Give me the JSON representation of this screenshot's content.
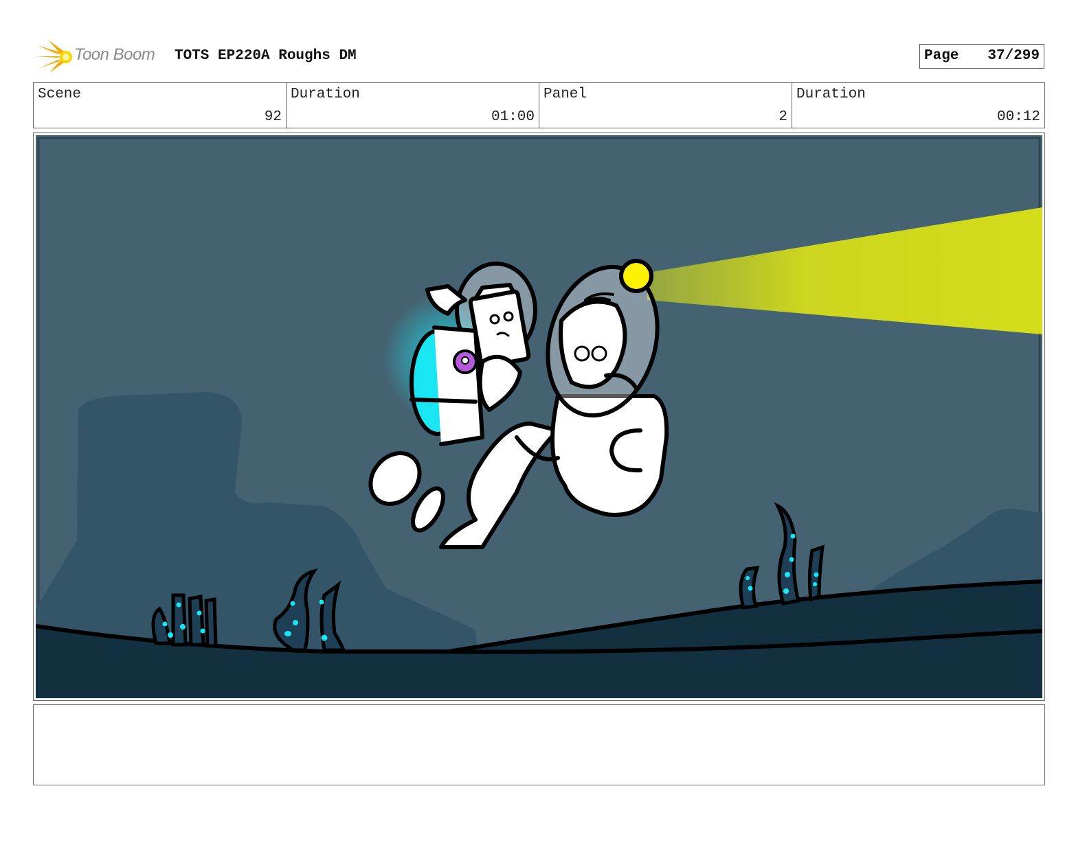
{
  "header": {
    "logo_text": "Toon Boom",
    "title": "TOTS EP220A Roughs DM",
    "page_label": "Page",
    "page_value": "37/299"
  },
  "info": {
    "scene_label": "Scene",
    "scene_value": "92",
    "scene_duration_label": "Duration",
    "scene_duration_value": "01:00",
    "panel_label": "Panel",
    "panel_value": "2",
    "panel_duration_label": "Duration",
    "panel_duration_value": "00:12"
  },
  "notes": {
    "text": ""
  },
  "colors": {
    "water": "#456272",
    "rocks": "#335567",
    "seabed": "#12303f",
    "beam": "#d4dc1a",
    "glow": "#19e6f2",
    "lamp": "#fff200",
    "logo_orange": "#f5a800",
    "logo_yellow": "#ffd400"
  }
}
